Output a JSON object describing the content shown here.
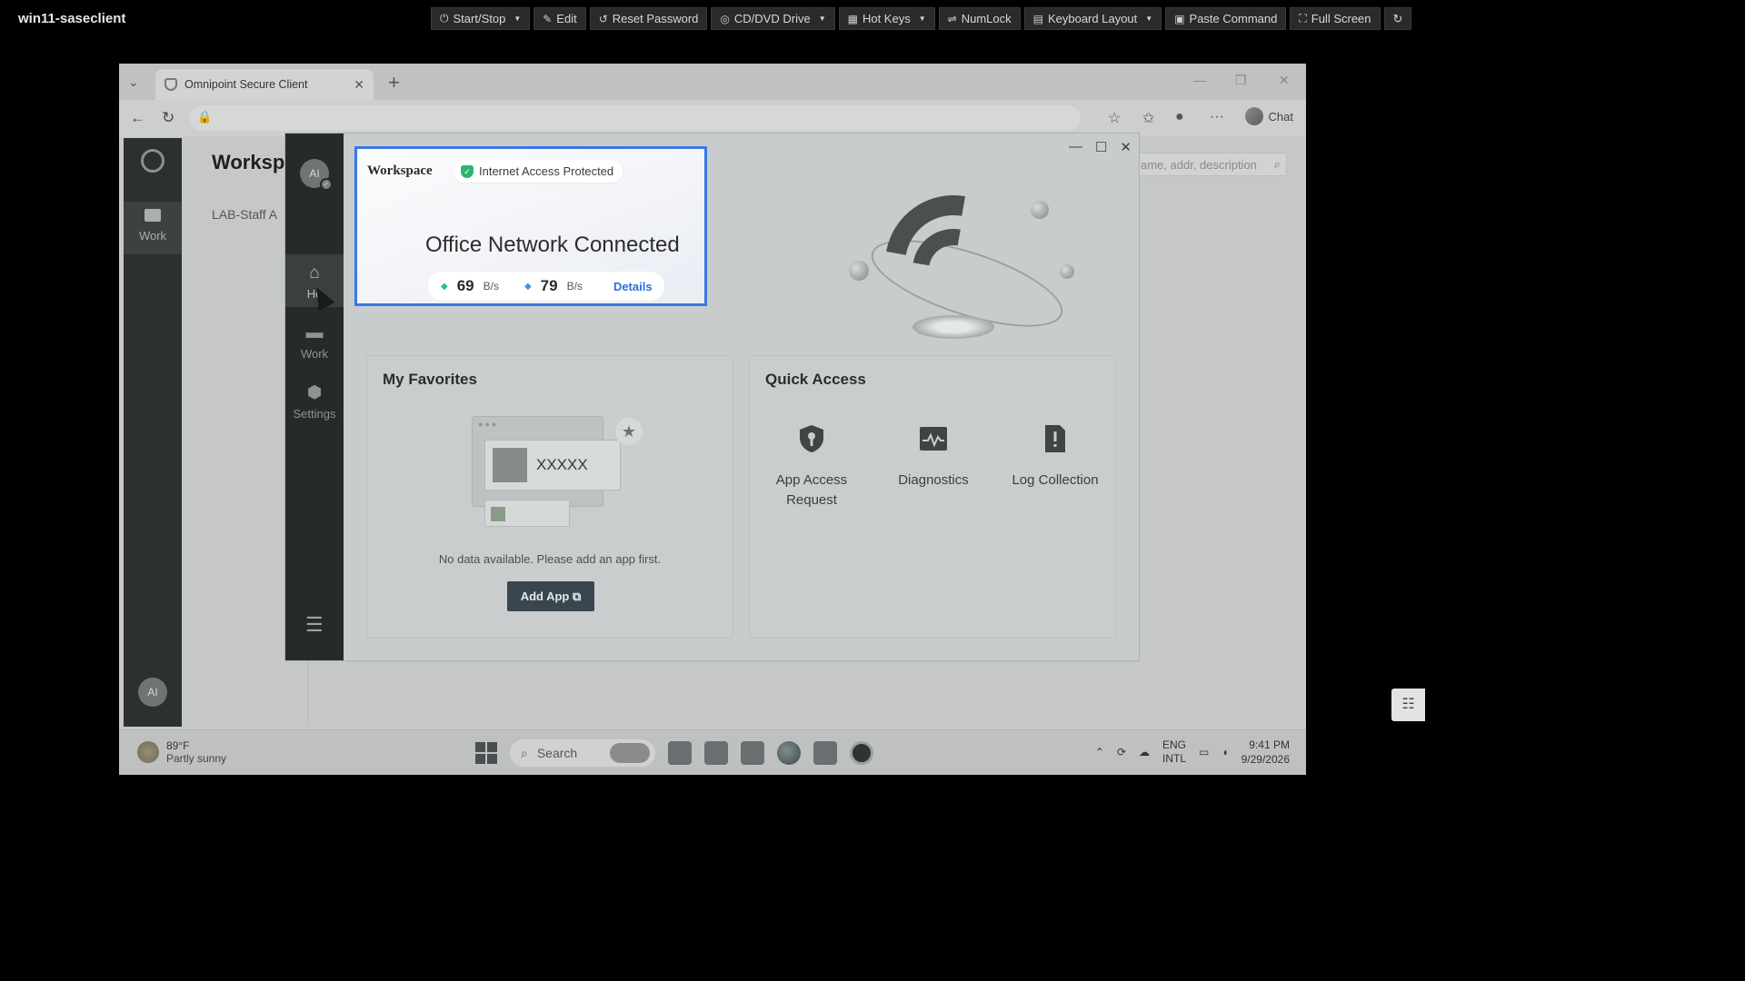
{
  "console": {
    "title": "win11-saseclient",
    "toolbar": [
      {
        "label": "Start/Stop",
        "icon": "power-icon",
        "glyph": "⏻",
        "dropdown": true
      },
      {
        "label": "Edit",
        "icon": "pencil-icon",
        "glyph": "✎",
        "dropdown": false
      },
      {
        "label": "Reset Password",
        "icon": "reset-icon",
        "glyph": "↺",
        "dropdown": false
      },
      {
        "label": "CD/DVD Drive",
        "icon": "disc-icon",
        "glyph": "◎",
        "dropdown": true
      },
      {
        "label": "Hot Keys",
        "icon": "grid-icon",
        "glyph": "▦",
        "dropdown": true
      },
      {
        "label": "NumLock",
        "icon": "swap-icon",
        "glyph": "⇌",
        "dropdown": false
      },
      {
        "label": "Keyboard Layout",
        "icon": "keyboard-icon",
        "glyph": "▤",
        "dropdown": true
      },
      {
        "label": "Paste Command",
        "icon": "paste-icon",
        "glyph": "▣",
        "dropdown": false
      },
      {
        "label": "Full Screen",
        "icon": "fullscreen-icon",
        "glyph": "⛶",
        "dropdown": false
      }
    ],
    "refresh_glyph": "↻"
  },
  "browser": {
    "tab_title": "Omnipoint Secure Client",
    "chat_label": "Chat"
  },
  "app": {
    "page_title": "Workspa",
    "subtitle": "LAB-Staff A",
    "search_placeholder": "ame, addr, description",
    "rail_work_label": "Work",
    "avatar_initials": "AI"
  },
  "modal": {
    "avatar_initials": "AI",
    "nav": [
      {
        "label": "Ho",
        "glyph": "⌂",
        "active": true
      },
      {
        "label": "Work",
        "glyph": "▬",
        "active": false
      },
      {
        "label": "Settings",
        "glyph": "⬢",
        "active": false
      }
    ],
    "favorites": {
      "title": "My Favorites",
      "placeholder_text": "XXXXX",
      "empty_message": "No data available. Please add an app first.",
      "add_button": "Add App"
    },
    "quick_access": {
      "title": "Quick Access",
      "items": [
        {
          "label": "App Access Request",
          "icon": "shield-key-icon"
        },
        {
          "label": "Diagnostics",
          "icon": "pulse-icon"
        },
        {
          "label": "Log Collection",
          "icon": "log-icon"
        }
      ]
    }
  },
  "popup": {
    "workspace_label": "Workspace",
    "status_badge": "Internet Access Protected",
    "headline": "Office Network Connected",
    "upload_value": "69",
    "upload_unit": "B/s",
    "download_value": "79",
    "download_unit": "B/s",
    "details_link": "Details",
    "accent_color": "#3a78e8",
    "status_color": "#2fb66c"
  },
  "taskbar": {
    "temperature": "89°F",
    "weather": "Partly sunny",
    "search_label": "Search",
    "lang_top": "ENG",
    "lang_bottom": "INTL",
    "time": "9:41 PM",
    "date": "9/29/2026"
  }
}
